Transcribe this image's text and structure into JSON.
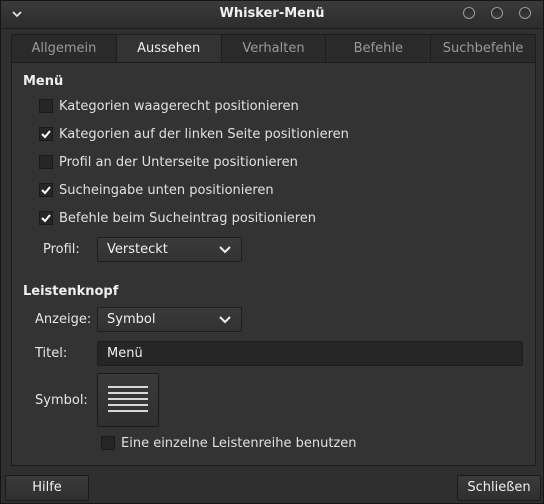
{
  "window": {
    "title": "Whisker-Menü"
  },
  "tabs": [
    {
      "label": "Allgemein",
      "active": false
    },
    {
      "label": "Aussehen",
      "active": true
    },
    {
      "label": "Verhalten",
      "active": false
    },
    {
      "label": "Befehle",
      "active": false
    },
    {
      "label": "Suchbefehle",
      "active": false
    }
  ],
  "menu_section": {
    "title": "Menü",
    "options": [
      {
        "label": "Kategorien waagerecht positionieren",
        "checked": false
      },
      {
        "label": "Kategorien auf der linken Seite positionieren",
        "checked": true
      },
      {
        "label": "Profil an der Unterseite positionieren",
        "checked": false
      },
      {
        "label": "Sucheingabe unten positionieren",
        "checked": true
      },
      {
        "label": "Befehle beim Sucheintrag positionieren",
        "checked": true
      }
    ],
    "profile_label": "Profil:",
    "profile_value": "Versteckt"
  },
  "panel_button_section": {
    "title": "Leistenknopf",
    "display_label": "Anzeige:",
    "display_value": "Symbol",
    "title_label": "Titel:",
    "title_value": "Menü",
    "symbol_label": "Symbol:",
    "symbol_icon": "menu-lines-icon",
    "single_row_label": "Eine einzelne Leistenreihe benutzen",
    "single_row_checked": false
  },
  "footer": {
    "help_label": "Hilfe",
    "close_label": "Schließen"
  },
  "colors": {
    "background": "#333333",
    "titlebar": "#2c2c2c",
    "check_accent": "#ffffff"
  }
}
